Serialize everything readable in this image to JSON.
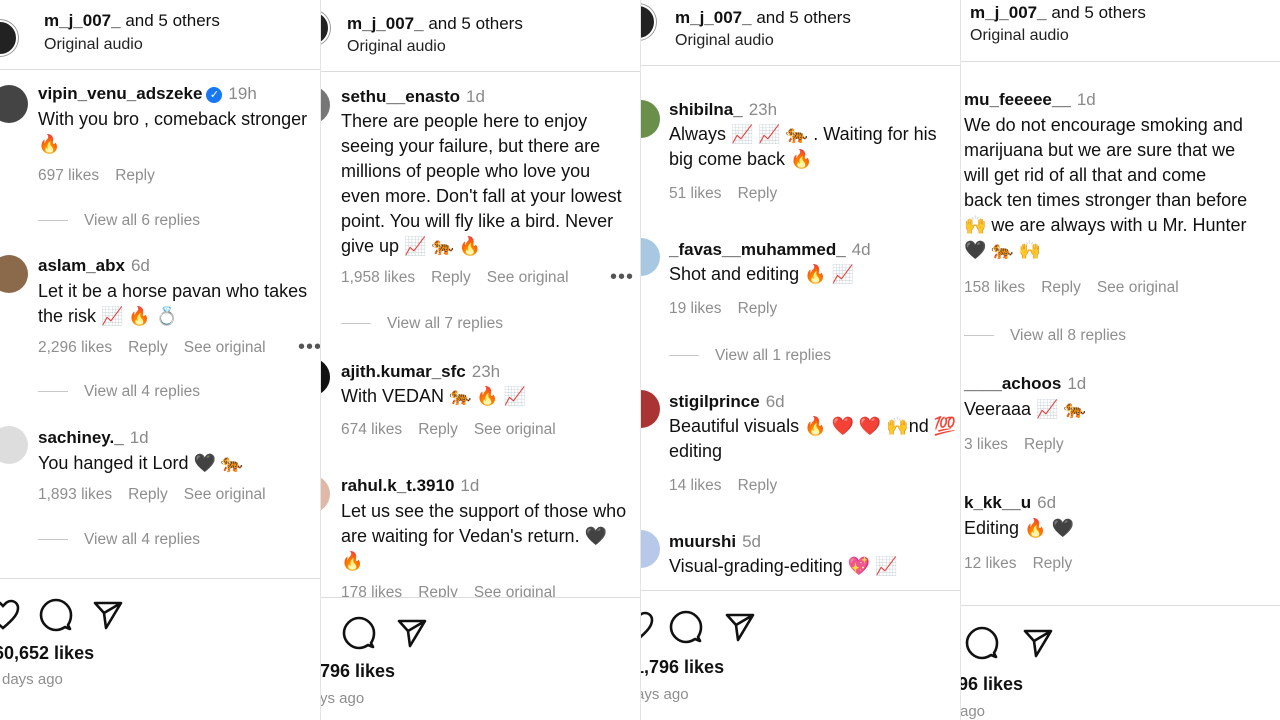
{
  "header": {
    "user": "m_j_007_",
    "others": "and 5 others",
    "audio": "Original audio"
  },
  "actions": {
    "reply": "Reply",
    "see_original": "See original",
    "more": "•••"
  },
  "panels": [
    {
      "comments": [
        {
          "user": "vipin_venu_adszeke",
          "verified": true,
          "time": "19h",
          "lines": [
            "With you bro , comeback stronger",
            "🔥"
          ],
          "likes": "697 likes",
          "see_original": false,
          "replies": "View all 6 replies"
        },
        {
          "user": "aslam_abx",
          "time": "6d",
          "lines": [
            "Let it be a horse pavan who takes",
            "the risk 📈 🔥 💍"
          ],
          "likes": "2,296 likes",
          "see_original": true,
          "more": true,
          "replies": "View all 4 replies"
        },
        {
          "user": "sachiney._",
          "time": "1d",
          "lines": [
            "You hanged it Lord 🖤 🐅"
          ],
          "likes": "1,893 likes",
          "see_original": true,
          "replies": "View all 4 replies"
        }
      ],
      "footer": {
        "likes": "60,652 likes",
        "ago": "days ago"
      }
    },
    {
      "comments": [
        {
          "user": "sethu__enasto",
          "time": "1d",
          "lines": [
            "There are people here to enjoy",
            "seeing your failure, but there are",
            "millions of people who love you",
            "even more. Don't fall at your lowest",
            "point. You will fly like a bird. Never",
            "give up 📈 🐅 🔥"
          ],
          "likes": "1,958 likes",
          "see_original": true,
          "more": true,
          "replies": "View all 7 replies"
        },
        {
          "user": "ajith.kumar_sfc",
          "time": "23h",
          "lines": [
            "With VEDAN 🐅 🔥 📈"
          ],
          "likes": "674 likes",
          "see_original": true
        },
        {
          "user": "rahul.k_t.3910",
          "time": "1d",
          "lines": [
            "Let us see the support of those who",
            "are waiting for Vedan's return. 🖤",
            "🔥"
          ],
          "likes": "178 likes",
          "see_original": true
        }
      ],
      "footer": {
        "likes": "796 likes",
        "ago": "ys ago"
      }
    },
    {
      "comments": [
        {
          "user": "shibilna_",
          "time": "23h",
          "lines": [
            "Always 📈 📈 🐅 . Waiting for his",
            "big come back 🔥"
          ],
          "likes": "51 likes",
          "see_original": false
        },
        {
          "user": "_favas__muhammed_",
          "time": "4d",
          "lines": [
            "Shot and editing 🔥 📈"
          ],
          "likes": "19 likes",
          "see_original": false,
          "replies": "View all 1 replies"
        },
        {
          "user": "stigilprince",
          "time": "6d",
          "lines": [
            "Beautiful visuals 🔥 ❤️ ❤️ 🙌nd 💯",
            "editing"
          ],
          "likes": "14 likes",
          "see_original": false
        },
        {
          "user": "muurshi",
          "time": "5d",
          "lines": [
            "Visual-grading-editing 💖 📈"
          ]
        }
      ],
      "footer": {
        "likes": "1,796 likes",
        "ago": "ays ago"
      }
    },
    {
      "comments": [
        {
          "user": "mu_feeeee__",
          "time": "1d",
          "lines": [
            "We do not encourage smoking and",
            "marijuana but we are sure that we",
            "will get rid of all that and come",
            "back ten times stronger than before",
            "🙌 we are always with u Mr. Hunter",
            "🖤 🐅 🙌"
          ],
          "likes": "158 likes",
          "see_original": true,
          "replies": "View all 8 replies"
        },
        {
          "user": "____achoos",
          "time": "1d",
          "lines": [
            "Veeraaa 📈 🐅"
          ],
          "likes": "3 likes",
          "see_original": false
        },
        {
          "user": "k_kk__u",
          "time": "6d",
          "lines": [
            "Editing 🔥 🖤"
          ],
          "likes": "12 likes",
          "see_original": false
        }
      ],
      "footer": {
        "likes": "96 likes",
        "ago": "ago"
      }
    }
  ],
  "icons": {
    "heart": "heart-icon",
    "comment": "comment-icon",
    "share": "send-icon"
  }
}
